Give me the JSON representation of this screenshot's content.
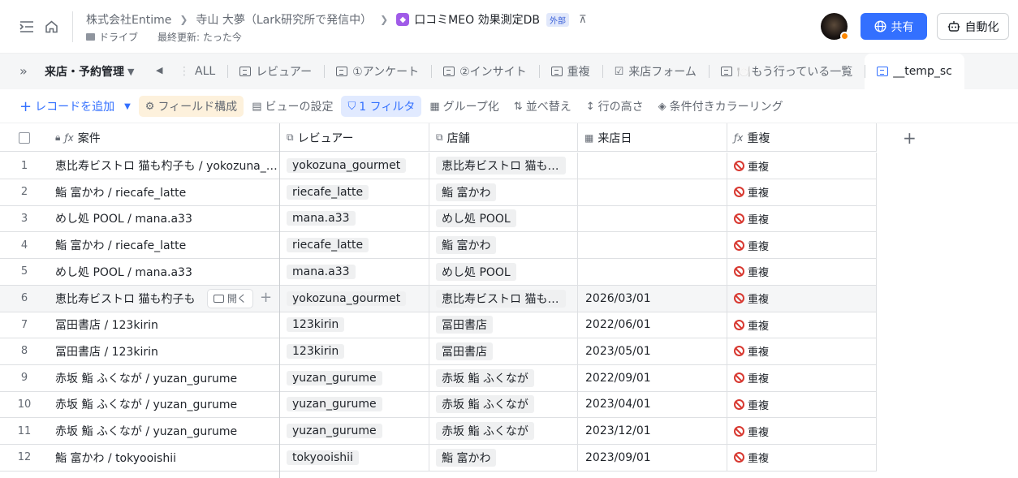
{
  "header": {
    "breadcrumbs": [
      "株式会社Entime",
      "寺山 大夢（Lark研究所で発信中）",
      "口コミMEO 効果測定DB"
    ],
    "external_badge": "外部",
    "drive_label": "ドライブ",
    "last_updated": "最終更新: たった今",
    "share_label": "共有",
    "automation_label": "自動化"
  },
  "tabsbar": {
    "group_label": "来店・予約管理",
    "tabs": [
      {
        "label": "ALL"
      },
      {
        "label": "レビュアー"
      },
      {
        "label": "①アンケート"
      },
      {
        "label": "②インサイト"
      },
      {
        "label": "重複"
      },
      {
        "label": "来店フォーム"
      },
      {
        "label": "🍽️もう行っている一覧"
      },
      {
        "label": "__temp_sc"
      }
    ]
  },
  "toolbar": {
    "add_record": "レコードを追加",
    "field_config": "フィールド構成",
    "view_settings": "ビューの設定",
    "filter": "1 フィルタ",
    "group": "グループ化",
    "sort": "並べ替え",
    "row_height": "行の高さ",
    "conditional_color": "条件付きカラーリング"
  },
  "grid": {
    "columns": [
      "案件",
      "レビュアー",
      "店舗",
      "来店日",
      "重複"
    ],
    "open_label": "開く",
    "rows": [
      {
        "num": "1",
        "title": "恵比寿ビストロ 猫も杓子も / yokozuna_gourmet",
        "reviewer": "yokozuna_gourmet",
        "store": "恵比寿ビストロ 猫も杓子も",
        "date": "",
        "dup": "重複"
      },
      {
        "num": "2",
        "title": "鮨 富かわ / riecafe_latte",
        "reviewer": "riecafe_latte",
        "store": "鮨 富かわ",
        "date": "",
        "dup": "重複"
      },
      {
        "num": "3",
        "title": "めし処 POOL / mana.a33",
        "reviewer": "mana.a33",
        "store": "めし処 POOL",
        "date": "",
        "dup": "重複"
      },
      {
        "num": "4",
        "title": "鮨 富かわ / riecafe_latte",
        "reviewer": "riecafe_latte",
        "store": "鮨 富かわ",
        "date": "",
        "dup": "重複"
      },
      {
        "num": "5",
        "title": "めし処 POOL / mana.a33",
        "reviewer": "mana.a33",
        "store": "めし処 POOL",
        "date": "",
        "dup": "重複"
      },
      {
        "num": "6",
        "title": "恵比寿ビストロ 猫も杓子も",
        "reviewer": "yokozuna_gourmet",
        "store": "恵比寿ビストロ 猫も杓子も",
        "date": "2026/03/01",
        "dup": "重複"
      },
      {
        "num": "7",
        "title": "冨田書店 / 123kirin",
        "reviewer": "123kirin",
        "store": "冨田書店",
        "date": "2022/06/01",
        "dup": "重複"
      },
      {
        "num": "8",
        "title": "冨田書店 / 123kirin",
        "reviewer": "123kirin",
        "store": "冨田書店",
        "date": "2023/05/01",
        "dup": "重複"
      },
      {
        "num": "9",
        "title": "赤坂 鮨 ふくなが / yuzan_gurume",
        "reviewer": "yuzan_gurume",
        "store": "赤坂 鮨 ふくなが",
        "date": "2022/09/01",
        "dup": "重複"
      },
      {
        "num": "10",
        "title": "赤坂 鮨 ふくなが / yuzan_gurume",
        "reviewer": "yuzan_gurume",
        "store": "赤坂 鮨 ふくなが",
        "date": "2023/04/01",
        "dup": "重複"
      },
      {
        "num": "11",
        "title": "赤坂 鮨 ふくなが / yuzan_gurume",
        "reviewer": "yuzan_gurume",
        "store": "赤坂 鮨 ふくなが",
        "date": "2023/12/01",
        "dup": "重複"
      },
      {
        "num": "12",
        "title": "鮨 富かわ / tokyooishii",
        "reviewer": "tokyooishii",
        "store": "鮨 富かわ",
        "date": "2023/09/01",
        "dup": "重複"
      }
    ]
  }
}
